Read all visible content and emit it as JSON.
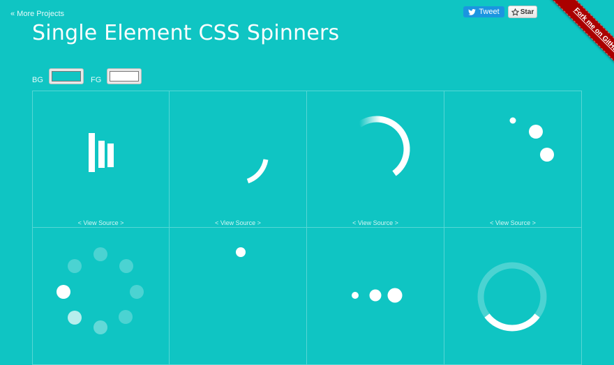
{
  "nav": {
    "more_projects": "« More Projects"
  },
  "header": {
    "title": "Single Element CSS Spinners"
  },
  "social": {
    "tweet": "Tweet",
    "star": "Star",
    "github_ribbon": "Fork me on GitHub"
  },
  "controls": {
    "bg_label": "BG",
    "fg_label": "FG",
    "bg_color": "#0fc5c3",
    "fg_color": "#ffffff"
  },
  "spinners": [
    {
      "id": "bars",
      "view_source": "< View Source >"
    },
    {
      "id": "arc-small",
      "view_source": "< View Source >"
    },
    {
      "id": "arc-large",
      "view_source": "< View Source >"
    },
    {
      "id": "orbit-dots",
      "view_source": "< View Source >"
    },
    {
      "id": "dot-ring",
      "view_source": ""
    },
    {
      "id": "single-dot",
      "view_source": ""
    },
    {
      "id": "three-dots",
      "view_source": ""
    },
    {
      "id": "ring-track",
      "view_source": ""
    }
  ],
  "colors": {
    "background": "#0fc5c3",
    "ribbon": "#aa0000",
    "tweet": "#1b95e0"
  }
}
